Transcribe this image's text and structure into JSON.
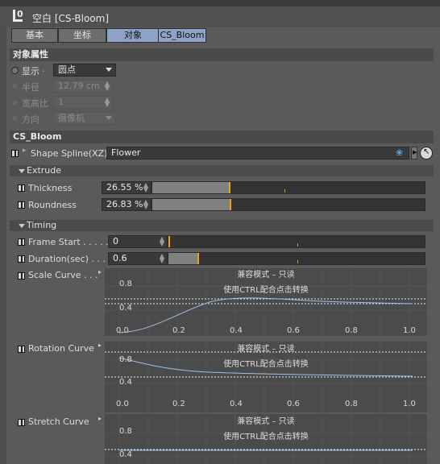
{
  "window": {
    "title": "空白 [CS-Bloom]",
    "icon_text": "0"
  },
  "tabs": [
    {
      "label": "基本"
    },
    {
      "label": "坐标"
    },
    {
      "label": "对象"
    },
    {
      "label": "CS_Bloom"
    }
  ],
  "object_properties": {
    "header": "对象属性",
    "display_label": "显示",
    "display_value": "圆点",
    "radius_label": "半径",
    "radius_value": "12.79 cm",
    "aspect_label": "宽高比",
    "aspect_value": "1",
    "orientation_label": "方向",
    "orientation_value": "摄像机"
  },
  "cs_bloom": {
    "header": "CS_Bloom",
    "shape_spline_label": "Shape Spline(XZ)",
    "shape_spline_value": "Flower"
  },
  "extrude": {
    "header": "Extrude",
    "thickness_label": "Thickness",
    "thickness_value": "26.55 %",
    "thickness_fraction": 0.2655,
    "roundness_label": "Roundness",
    "roundness_value": "26.83 %",
    "roundness_fraction": 0.2683
  },
  "timing": {
    "header": "Timing",
    "frame_start_label": "Frame Start . . . . .",
    "frame_start_value": "0",
    "duration_label": "Duration(sec) . . .",
    "duration_value": "0.6",
    "scale_curve_label": "Scale Curve . . .",
    "rotation_curve_label": "Rotation Curve",
    "stretch_curve_label": "Stretch Curve"
  },
  "curve_overlay": {
    "line1": "兼容模式 – 只读",
    "line2": "使用CTRL配合点击转换"
  },
  "curve_axis": {
    "y_labels": [
      "0.8",
      "0.4",
      "0.0"
    ],
    "x_labels": [
      "0.0",
      "0.2",
      "0.4",
      "0.6",
      "0.8",
      "1.0"
    ]
  },
  "colors": {
    "selected_tab": "#8fa3c9",
    "slider_thumb": "#f0a020"
  }
}
